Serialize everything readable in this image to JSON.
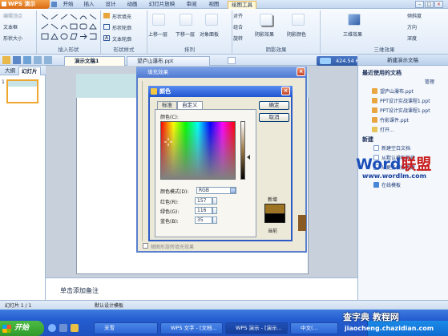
{
  "app": {
    "name": "WPS 演示"
  },
  "menu_tabs": [
    "开始",
    "插入",
    "设计",
    "动画",
    "幻灯片放映",
    "审阅",
    "视图",
    "绘图工具"
  ],
  "ribbon": {
    "left_buttons": [
      "编辑顶点",
      "文本框",
      "形状大小"
    ],
    "group_insert_shape": "插入形状",
    "group_shape_style": "形状样式",
    "shape_style_buttons": [
      "形状填充",
      "形状轮廓",
      "文本轮廓"
    ],
    "group_arrange": "排列",
    "arrange_buttons": [
      "上移一层",
      "下移一层",
      "对象面板"
    ],
    "arrange_small": [
      "对齐",
      "组合",
      "旋转"
    ],
    "group_shadow": "阴影效果",
    "shadow_buttons": [
      "阴影效果",
      "阴影颜色"
    ],
    "group_3d": "三维效果",
    "three_d_buttons": [
      "三维效果",
      "倾斜度",
      "方向",
      "深度"
    ]
  },
  "tabs": {
    "doc_tabs": [
      "演示文稿1",
      "望庐山瀑布.ppt"
    ],
    "speed": "424.54 KB/s"
  },
  "left_panel": {
    "tabs": [
      "大纲",
      "幻灯片"
    ],
    "slide_number": "1"
  },
  "fill_dialog": {
    "title": "填充效果",
    "bottom_checkbox": "随图形旋转填充效果"
  },
  "color_dialog": {
    "title": "颜色",
    "tabs": [
      "标准",
      "自定义"
    ],
    "colors_label": "颜色(C):",
    "mode_label": "颜色模式(D):",
    "mode_value": "RGB",
    "red_label": "红色(R):",
    "red_value": "157",
    "green_label": "绿色(G):",
    "green_value": "116",
    "blue_label": "蓝色(B):",
    "blue_value": "35",
    "ok": "确定",
    "cancel": "取消",
    "new_label": "新增",
    "current_label": "当前",
    "new_color": "#9d7423",
    "current_color": "#000000"
  },
  "notes": {
    "placeholder": "单击添加备注"
  },
  "right_panel": {
    "header": "新建演示文稿",
    "recent_title": "最近使用的文档",
    "manage": "管理",
    "recent_items": [
      "望庐山瀑布.ppt",
      "PPT设计实战课程1.ppt",
      "PPT设计实战课程1.ppt",
      "竹影课件.ppt",
      "打开..."
    ],
    "new_title": "新建",
    "new_items": [
      "新建空白文档",
      "从默认模板新建",
      "从更多模板新建",
      "在线模板"
    ]
  },
  "status": {
    "slide": "幻灯片 1 / 1",
    "template": "默认设计模板"
  },
  "taskbar": {
    "start": "开始",
    "items": [
      "末雪",
      "WPS 文字 - [文档...",
      "WPS 演示 - [演示...",
      "中文(..."
    ],
    "site_cn": "查字典 教程网",
    "site_url": "jiaocheng.chazidian.com"
  },
  "watermark": {
    "brand_w": "Word",
    "brand_cn": "联盟",
    "url": "www.wordlm.com"
  }
}
